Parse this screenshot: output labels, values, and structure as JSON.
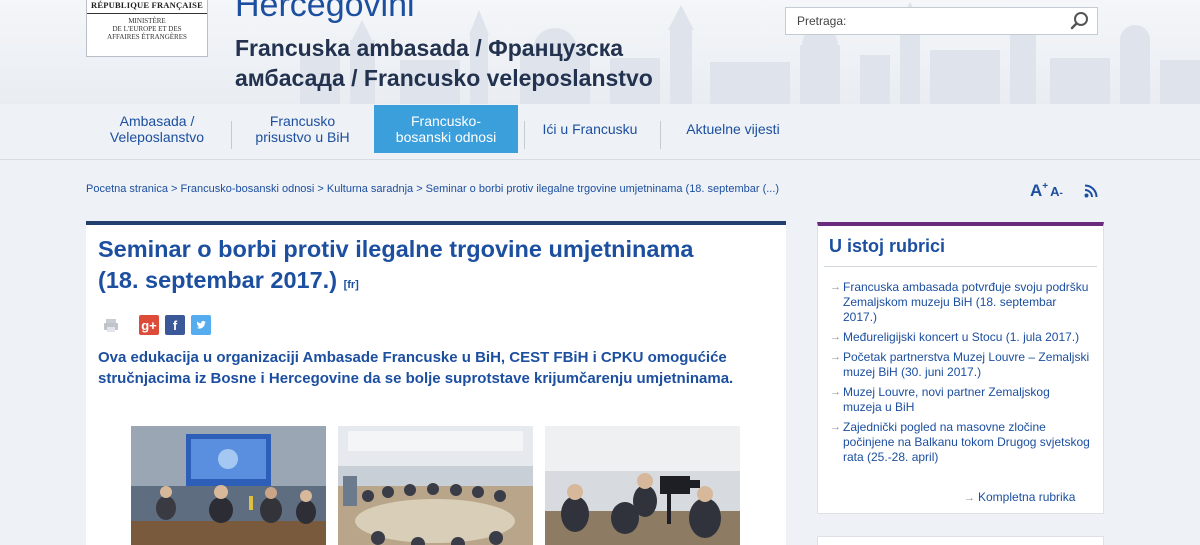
{
  "header": {
    "logo": {
      "republic": "RÉPUBLIQUE FRANÇAISE",
      "ministry_lines": [
        "MINISTÈRE",
        "DE L'EUROPE ET DES",
        "AFFAIRES ÉTRANGÈRES"
      ]
    },
    "country": "Hercegovini",
    "embassy_line1": "Francuska ambasada / Французска",
    "embassy_line2": "амбасада / Francusko veleposlanstvo",
    "search": {
      "placeholder": "Pretraga:",
      "icon": "search-icon"
    }
  },
  "nav": {
    "items": [
      {
        "line1": "Ambasada /",
        "line2": "Veleposlanstvo",
        "active": false
      },
      {
        "line1": "Francusko",
        "line2": "prisustvo u BiH",
        "active": false
      },
      {
        "line1": "Francusko-",
        "line2": "bosanski odnosi",
        "active": true
      },
      {
        "line1": "Ići u Francusku",
        "line2": "",
        "active": false
      },
      {
        "line1": "Aktuelne vijesti",
        "line2": "",
        "active": false
      }
    ]
  },
  "breadcrumb": "Pocetna stranica > Francusko-bosanski odnosi > Kulturna saradnja > Seminar o borbi protiv ilegalne trgovine umjetninama (18. septembar (...)",
  "font_tools": {
    "increase": "A",
    "increase_sup": "+",
    "decrease": "A",
    "decrease_sup": "-",
    "rss_icon": "rss-icon"
  },
  "article": {
    "title_line1": "Seminar o borbi protiv ilegalne trgovine umjetninama",
    "title_line2": "(18. septembar 2017.)",
    "lang": "[fr]",
    "share": {
      "print_icon": "print-icon",
      "gplus": "g+",
      "facebook": "f",
      "twitter_icon": "twitter-icon"
    },
    "lead": "Ova edukacija u organizaciji Ambasade Francuske u BiH, CEST FBiH i CPKU omogućiće stručnjacima iz Bosne i Hercegovine da se bolje suprotstave krijumčarenju umjetninama."
  },
  "sidebar": {
    "title": "U istoj rubrici",
    "items": [
      "Francuska ambasada potvrđuje svoju podršku Zemaljskom muzeju BiH (18. septembar 2017.)",
      "Međureligijski koncert u Stocu (1. jula 2017.)",
      "Početak partnerstva Muzej Louvre – Zemaljski muzej BiH (30. juni 2017.)",
      "Muzej Louvre, novi partner Zemaljskog muzeja u BiH",
      "Zajednički pogled na masovne zločine počinjene na Balkanu tokom Drugog svjetskog rata (25.-28. april)"
    ],
    "complete": "Kompletna rubrika"
  },
  "colors": {
    "brand_blue": "#1c4fa0",
    "nav_active": "#3b9fdc",
    "article_bar": "#22406e",
    "sidebar_bar": "#6a2a7e"
  }
}
